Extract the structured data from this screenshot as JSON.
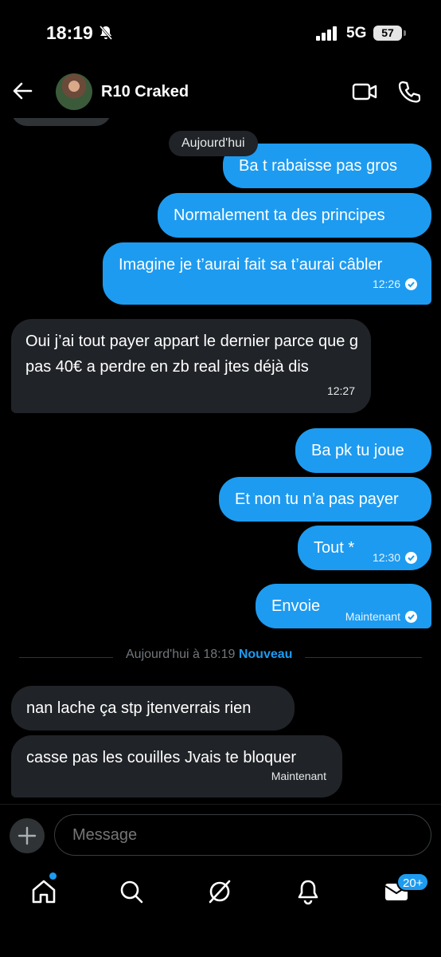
{
  "status_bar": {
    "time": "18:19",
    "network": "5G",
    "battery": "57"
  },
  "header": {
    "contact_name": "R10 Craked"
  },
  "day_pill": "Aujourd'hui",
  "messages": [
    {
      "text": "Ba t rabaisse pas gros"
    },
    {
      "text": "Normalement ta des principes"
    },
    {
      "text": "Imagine je t’aurai fait sa t’aurai câbler",
      "time": "12:26"
    },
    {
      "text": "Oui j’ai tout payer appart le dernier parce que g pas 40€ a perdre en zb real jtes déjà dis",
      "time": "12:27"
    },
    {
      "text": "Ba pk tu joue"
    },
    {
      "text": "Et non tu n’a pas payer"
    },
    {
      "text": "Tout *",
      "time": "12:30"
    },
    {
      "text": "Envoie",
      "time": "Maintenant"
    },
    {
      "text": "nan lache ça stp jtenverrais rien"
    },
    {
      "text": "casse pas les couilles Jvais te bloquer",
      "time": "Maintenant"
    }
  ],
  "divider": {
    "label": "Aujourd'hui à 18:19",
    "new_label": "Nouveau"
  },
  "composer": {
    "placeholder": "Message"
  },
  "nav": {
    "messages_badge": "20+"
  },
  "colors": {
    "accent": "#1d9bf0",
    "incoming_bubble": "#202327",
    "background": "#000000"
  }
}
